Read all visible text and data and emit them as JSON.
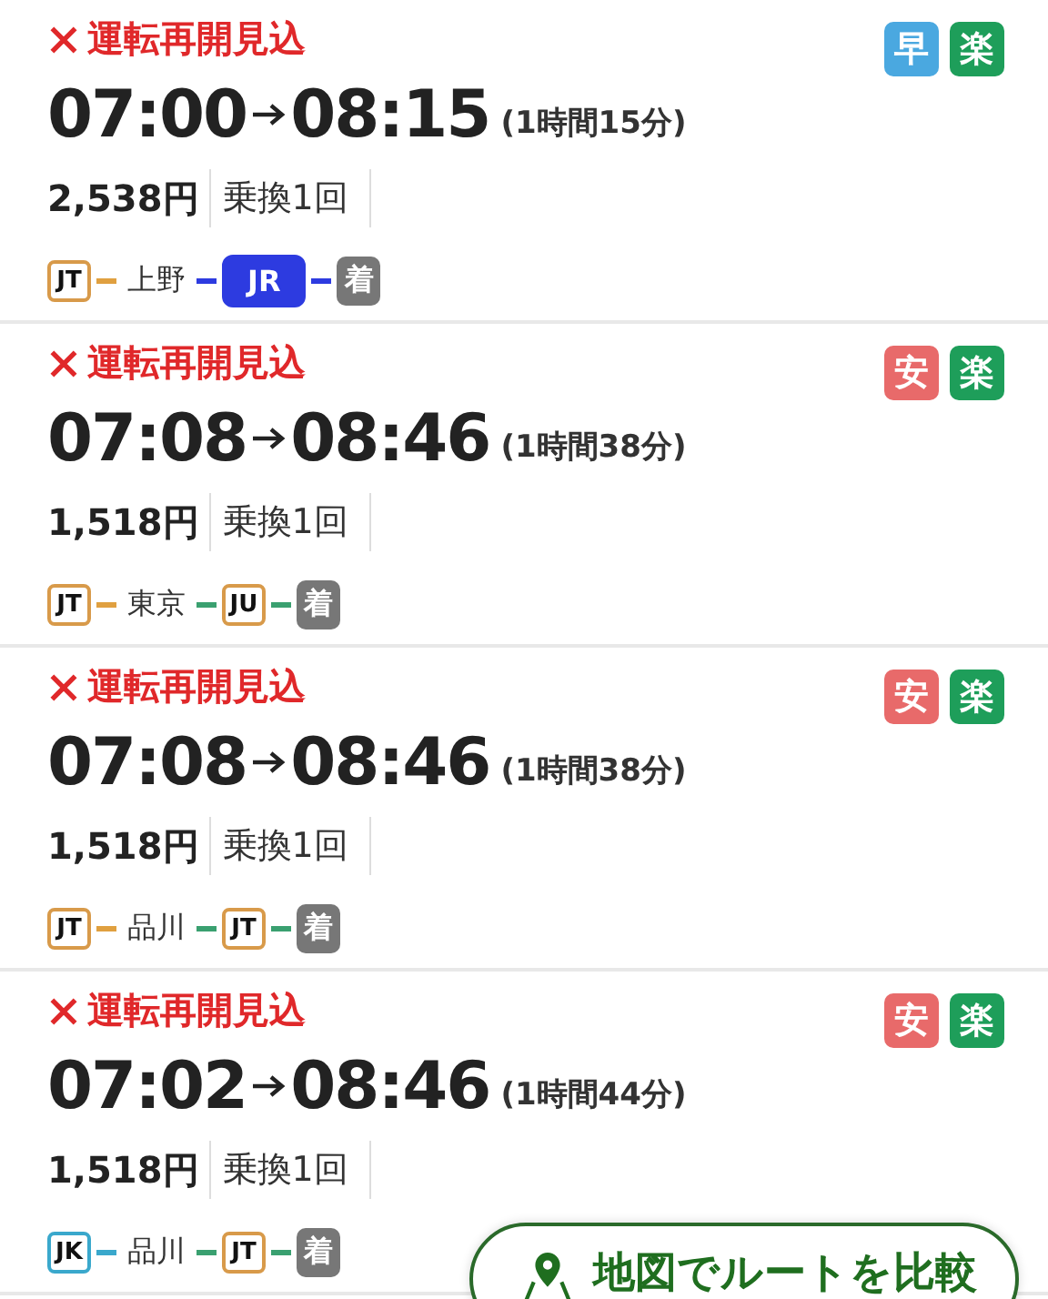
{
  "routes": [
    {
      "status": "運転再開見込",
      "tags": [
        {
          "label": "早",
          "color": "#4aa8e0"
        },
        {
          "label": "楽",
          "color": "#1e9e5a"
        }
      ],
      "departure": "07:00",
      "arrival": "08:15",
      "duration": "(1時間15分)",
      "fare": "2,538円",
      "transfers": "乗換1回",
      "steps": [
        {
          "kind": "line",
          "label": "JT",
          "color": "#d89a4a",
          "filled": false
        },
        {
          "kind": "connector",
          "color": "#e0a040"
        },
        {
          "kind": "station",
          "label": "上野"
        },
        {
          "kind": "connector",
          "color": "#2d3be0"
        },
        {
          "kind": "line",
          "label": "JR",
          "color": "#2d3be0",
          "filled": true
        },
        {
          "kind": "connector",
          "color": "#2d3be0"
        },
        {
          "kind": "arrive",
          "label": "着"
        }
      ]
    },
    {
      "status": "運転再開見込",
      "tags": [
        {
          "label": "安",
          "color": "#e86a6a"
        },
        {
          "label": "楽",
          "color": "#1e9e5a"
        }
      ],
      "departure": "07:08",
      "arrival": "08:46",
      "duration": "(1時間38分)",
      "fare": "1,518円",
      "transfers": "乗換1回",
      "steps": [
        {
          "kind": "line",
          "label": "JT",
          "color": "#d89a4a",
          "filled": false
        },
        {
          "kind": "connector",
          "color": "#e0a040"
        },
        {
          "kind": "station",
          "label": "東京"
        },
        {
          "kind": "connector",
          "color": "#3aa070"
        },
        {
          "kind": "line",
          "label": "JU",
          "color": "#d89a4a",
          "filled": false
        },
        {
          "kind": "connector",
          "color": "#3aa070"
        },
        {
          "kind": "arrive",
          "label": "着"
        }
      ]
    },
    {
      "status": "運転再開見込",
      "tags": [
        {
          "label": "安",
          "color": "#e86a6a"
        },
        {
          "label": "楽",
          "color": "#1e9e5a"
        }
      ],
      "departure": "07:08",
      "arrival": "08:46",
      "duration": "(1時間38分)",
      "fare": "1,518円",
      "transfers": "乗換1回",
      "steps": [
        {
          "kind": "line",
          "label": "JT",
          "color": "#d89a4a",
          "filled": false
        },
        {
          "kind": "connector",
          "color": "#e0a040"
        },
        {
          "kind": "station",
          "label": "品川"
        },
        {
          "kind": "connector",
          "color": "#3aa070"
        },
        {
          "kind": "line",
          "label": "JT",
          "color": "#d89a4a",
          "filled": false
        },
        {
          "kind": "connector",
          "color": "#3aa070"
        },
        {
          "kind": "arrive",
          "label": "着"
        }
      ]
    },
    {
      "status": "運転再開見込",
      "tags": [
        {
          "label": "安",
          "color": "#e86a6a"
        },
        {
          "label": "楽",
          "color": "#1e9e5a"
        }
      ],
      "departure": "07:02",
      "arrival": "08:46",
      "duration": "(1時間44分)",
      "fare": "1,518円",
      "transfers": "乗換1回",
      "steps": [
        {
          "kind": "line",
          "label": "JK",
          "color": "#3aa8cc",
          "filled": false
        },
        {
          "kind": "connector",
          "color": "#3aa8cc"
        },
        {
          "kind": "station",
          "label": "品川"
        },
        {
          "kind": "connector",
          "color": "#3aa070"
        },
        {
          "kind": "line",
          "label": "JT",
          "color": "#d89a4a",
          "filled": false
        },
        {
          "kind": "connector",
          "color": "#3aa070"
        },
        {
          "kind": "arrive",
          "label": "着"
        }
      ]
    }
  ],
  "map_button": {
    "label": "地図でルートを比較"
  }
}
